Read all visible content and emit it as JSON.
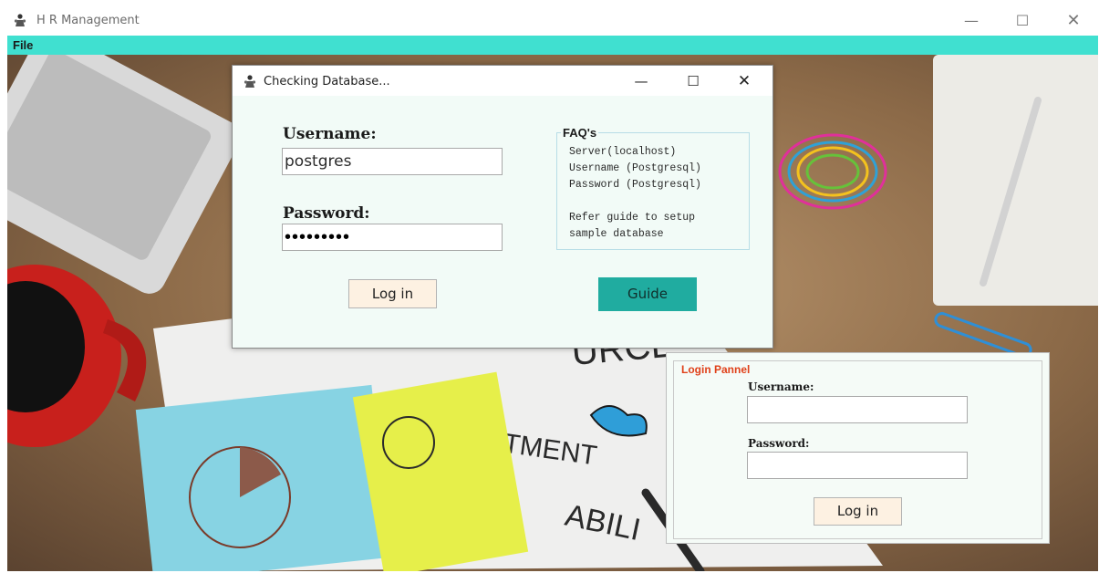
{
  "window": {
    "title": "H R Management",
    "controls": {
      "minimize": "—",
      "maximize": "☐",
      "close": "✕"
    }
  },
  "menubar": {
    "file_label": "File"
  },
  "theme": {
    "menubar_color": "#40e0d0",
    "guide_button_color": "#20aca0",
    "panel_title_color": "#e0411a"
  },
  "db_dialog": {
    "title": "Checking Database...",
    "controls": {
      "minimize": "—",
      "maximize": "☐",
      "close": "✕"
    },
    "username_label": "Username:",
    "username_value": "postgres",
    "password_label": "Password:",
    "password_value": "•••••••••",
    "login_button": "Log in",
    "guide_button": "Guide",
    "faq": {
      "title": "FAQ's",
      "lines": [
        "Server(localhost)",
        "Username (Postgresql)",
        "Password (Postgresql)",
        "",
        "Refer guide to setup",
        "sample database"
      ]
    }
  },
  "login_panel": {
    "title": "Login Pannel",
    "username_label": "Username:",
    "username_value": "",
    "password_label": "Password:",
    "password_value": "",
    "login_button": "Log in"
  }
}
